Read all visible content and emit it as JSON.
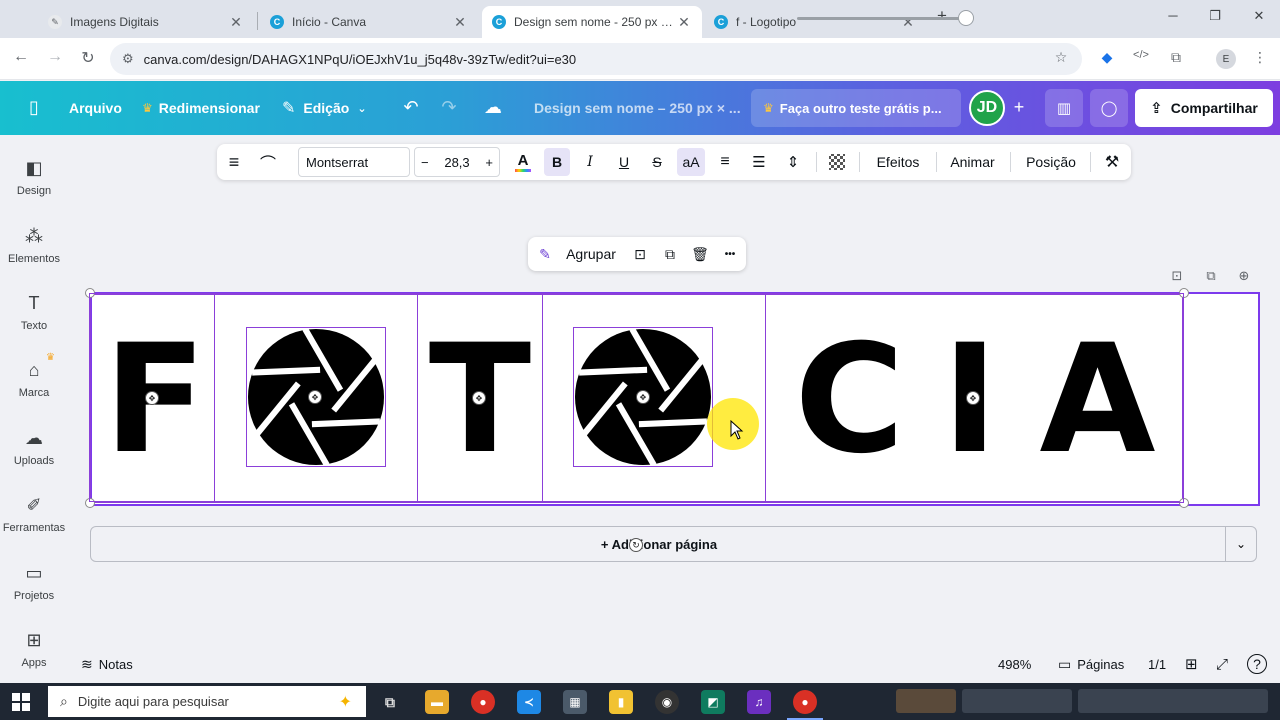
{
  "browser": {
    "tabs": [
      {
        "title": "Imagens Digitais",
        "active": false
      },
      {
        "title": "Início - Canva",
        "active": false
      },
      {
        "title": "Design sem nome - 250 px × 4",
        "active": true
      },
      {
        "title": "f - Logotipo",
        "active": false
      }
    ],
    "new_tab": "+",
    "url": "canva.com/design/DAHAGX1NPqU/iOEJxhV1u_j5q48v-39zTw/edit?ui=e30",
    "profile_initial": "E"
  },
  "canva_header": {
    "file_menu": "Arquivo",
    "resize": "Redimensionar",
    "editing": "Edição",
    "doc_title": "Design sem nome – 250 px × ...",
    "trial": "Faça outro teste grátis p...",
    "avatar": "JD",
    "share": "Compartilhar"
  },
  "sidebar": {
    "items": [
      {
        "label": "Design",
        "icon": "design-icon"
      },
      {
        "label": "Elementos",
        "icon": "elements-icon"
      },
      {
        "label": "Texto",
        "icon": "text-icon"
      },
      {
        "label": "Marca",
        "icon": "brand-icon"
      },
      {
        "label": "Uploads",
        "icon": "upload-icon"
      },
      {
        "label": "Ferramentas",
        "icon": "tools-icon"
      },
      {
        "label": "Projetos",
        "icon": "folder-icon"
      },
      {
        "label": "Apps",
        "icon": "apps-icon"
      }
    ]
  },
  "text_toolbar": {
    "font": "Montserrat",
    "size": "28,3",
    "minus": "−",
    "plus": "+",
    "case_label": "aA",
    "effects": "Efeitos",
    "animate": "Animar",
    "position": "Posição"
  },
  "selection_toolbar": {
    "group": "Agrupar",
    "more": "•••"
  },
  "canvas": {
    "letters": [
      "F",
      "T",
      "C",
      "I",
      "A"
    ],
    "accent": "#7c3aed"
  },
  "add_page": "+ Adicionar página",
  "status": {
    "notes": "Notas",
    "zoom": "498%",
    "zoom_fraction": 0.96,
    "pages_label": "Páginas",
    "page_count": "1/1"
  },
  "taskbar": {
    "search_placeholder": "Digite aqui para pesquisar"
  }
}
